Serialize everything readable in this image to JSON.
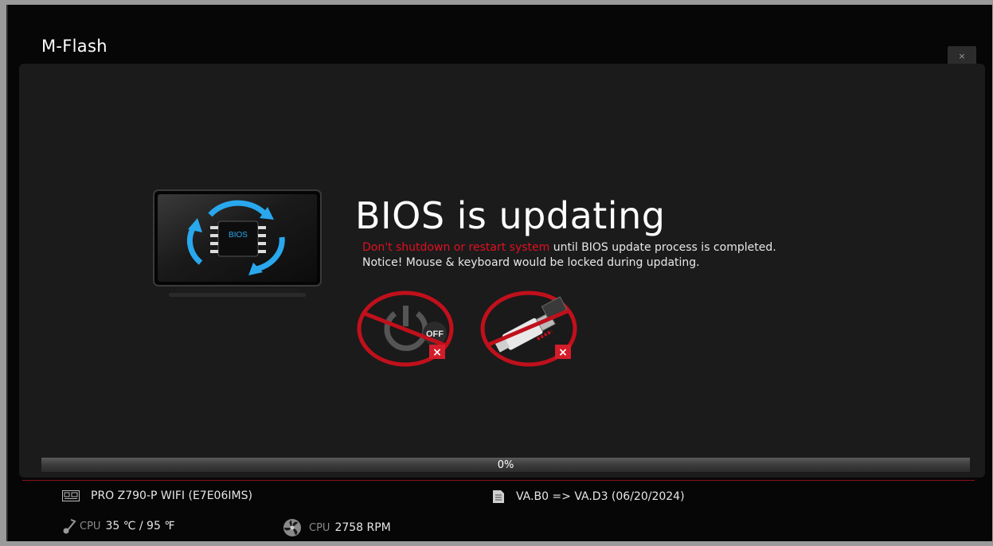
{
  "window": {
    "title": "M-Flash",
    "close_label": "×"
  },
  "main": {
    "bios_chip_label": "BIOS",
    "headline": "BIOS is updating",
    "warning_red": "Don't shutdown or restart system",
    "warning_rest": " until BIOS update process is completed.",
    "notice": "Notice! Mouse & keyboard would be locked during updating.",
    "power_badge": "OFF",
    "power_x": "×",
    "usb_x": "×"
  },
  "progress": {
    "value": 0,
    "label": "0%"
  },
  "status": {
    "board": "PRO Z790-P WIFI (E7E06IMS)",
    "bios_version": "VA.B0 => VA.D3 (06/20/2024)",
    "cpu_tag": "CPU",
    "cpu_temp": "35 ℃ / 95 ℉",
    "fan_tag": "CPU",
    "fan_speed": "2758 RPM"
  },
  "icons": [
    "motherboard-icon",
    "bios-file-icon",
    "thermometer-icon",
    "fan-icon",
    "power-off-icon",
    "usb-unplug-icon",
    "bios-chip-icon"
  ],
  "colors": {
    "accent": "#e01020",
    "background": "#1b1b1b",
    "chip_glow": "#29a8ee"
  }
}
